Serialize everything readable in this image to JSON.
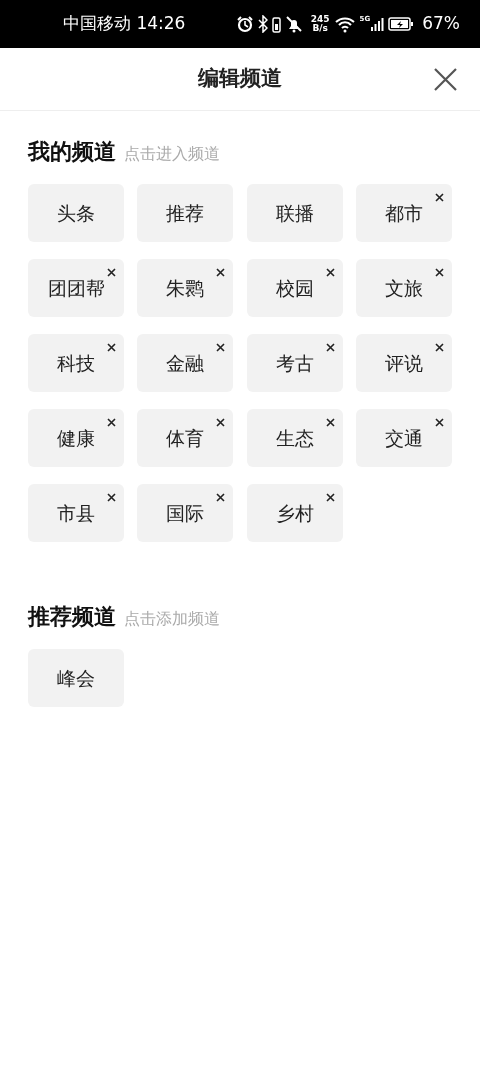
{
  "status_bar": {
    "carrier_time": "中国移动 14:26",
    "net_speed": "245",
    "net_unit": "B/s",
    "network": "5G",
    "battery": "67%"
  },
  "header": {
    "title": "编辑频道"
  },
  "my_channels": {
    "title": "我的频道",
    "hint": "点击进入频道",
    "items": [
      {
        "label": "头条",
        "removable": false
      },
      {
        "label": "推荐",
        "removable": false
      },
      {
        "label": "联播",
        "removable": false
      },
      {
        "label": "都市",
        "removable": true
      },
      {
        "label": "团团帮",
        "removable": true
      },
      {
        "label": "朱鹮",
        "removable": true
      },
      {
        "label": "校园",
        "removable": true
      },
      {
        "label": "文旅",
        "removable": true
      },
      {
        "label": "科技",
        "removable": true
      },
      {
        "label": "金融",
        "removable": true
      },
      {
        "label": "考古",
        "removable": true
      },
      {
        "label": "评说",
        "removable": true
      },
      {
        "label": "健康",
        "removable": true
      },
      {
        "label": "体育",
        "removable": true
      },
      {
        "label": "生态",
        "removable": true
      },
      {
        "label": "交通",
        "removable": true
      },
      {
        "label": "市县",
        "removable": true
      },
      {
        "label": "国际",
        "removable": true
      },
      {
        "label": "乡村",
        "removable": true
      }
    ]
  },
  "recommended_channels": {
    "title": "推荐频道",
    "hint": "点击添加频道",
    "items": [
      {
        "label": "峰会",
        "removable": false
      }
    ]
  }
}
